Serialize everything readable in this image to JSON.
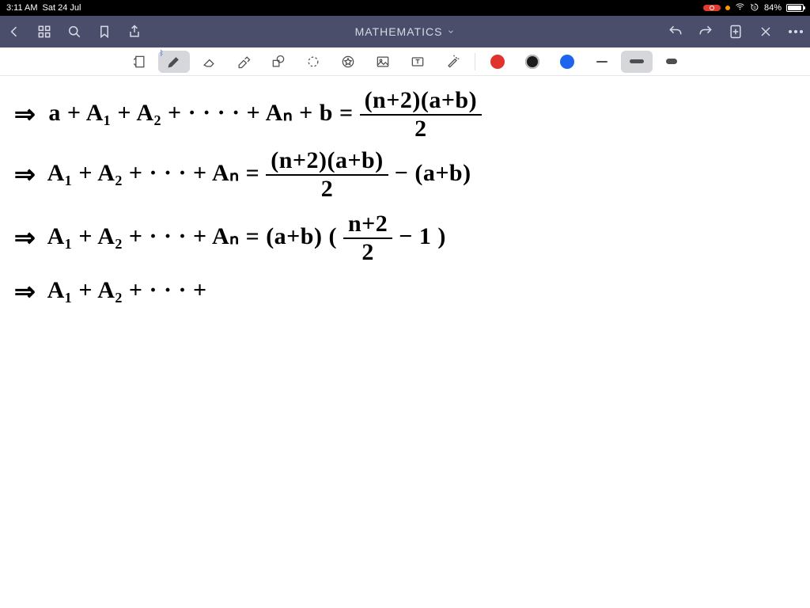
{
  "status": {
    "time": "3:11 AM",
    "date": "Sat 24 Jul",
    "battery_pct": "84%"
  },
  "header": {
    "title": "MATHEMATICS"
  },
  "toolbar": {
    "tools": {
      "page": "page-view",
      "pen": "pen",
      "eraser": "eraser",
      "highlighter": "highlighter",
      "shapes": "shapes",
      "lasso": "lasso",
      "favorites": "favorites",
      "image": "image-insert",
      "text": "text-box",
      "laser": "laser-pointer"
    },
    "colors": {
      "red": "#e0332c",
      "black": "#1b1b1d",
      "blue": "#1f64ef"
    },
    "selected_tool": "pen",
    "selected_color": "black",
    "selected_thickness": "medium"
  },
  "handwriting": {
    "line1_lhs": "a + A₁ + A₂ + · · · · + Aₙ + b  =",
    "line1_frac_top": "(n+2)(a+b)",
    "line1_frac_bot": "2",
    "line2_lhs": "A₁ + A₂ + · · · + Aₙ  =",
    "line2_frac_top": "(n+2)(a+b)",
    "line2_frac_bot": "2",
    "line2_tail": "−  (a+b)",
    "line3_lhs": "A₁ + A₂ + · · · + Aₙ  =  (a+b) (",
    "line3_frac_top": "n+2",
    "line3_frac_bot": "2",
    "line3_tail": "− 1 )",
    "line4": "A₁ + A₂ + · · · +"
  }
}
